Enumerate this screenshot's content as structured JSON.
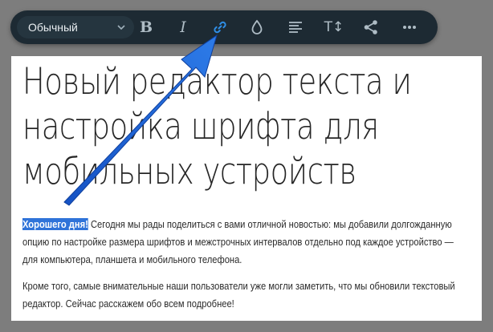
{
  "toolbar": {
    "style_select": {
      "value": "Обычный"
    },
    "bold_label": "B",
    "italic_label": "I",
    "text_size_label": "T↕",
    "active_color": "#2f8ee6"
  },
  "document": {
    "title": "Новый редактор текста и настройка шрифта для мобильных устройств",
    "p1_highlight": "Хорошего дня!",
    "p1_rest": " Сегодня мы рады поделиться с вами отличной новостью: мы добавили долгожданную опцию по настройке размера шрифтов и межстрочных интервалов отдельно под каждое устройство — для компьютера, планшета и мобильного телефона.",
    "p2": "Кроме того, самые внимательные наши пользователи уже могли заметить, что мы обновили текстовый редактор. Сейчас расскажем обо всем подробнее!"
  },
  "annotation": {
    "arrow_color": "#1e63d6",
    "points_to": "link-icon"
  }
}
